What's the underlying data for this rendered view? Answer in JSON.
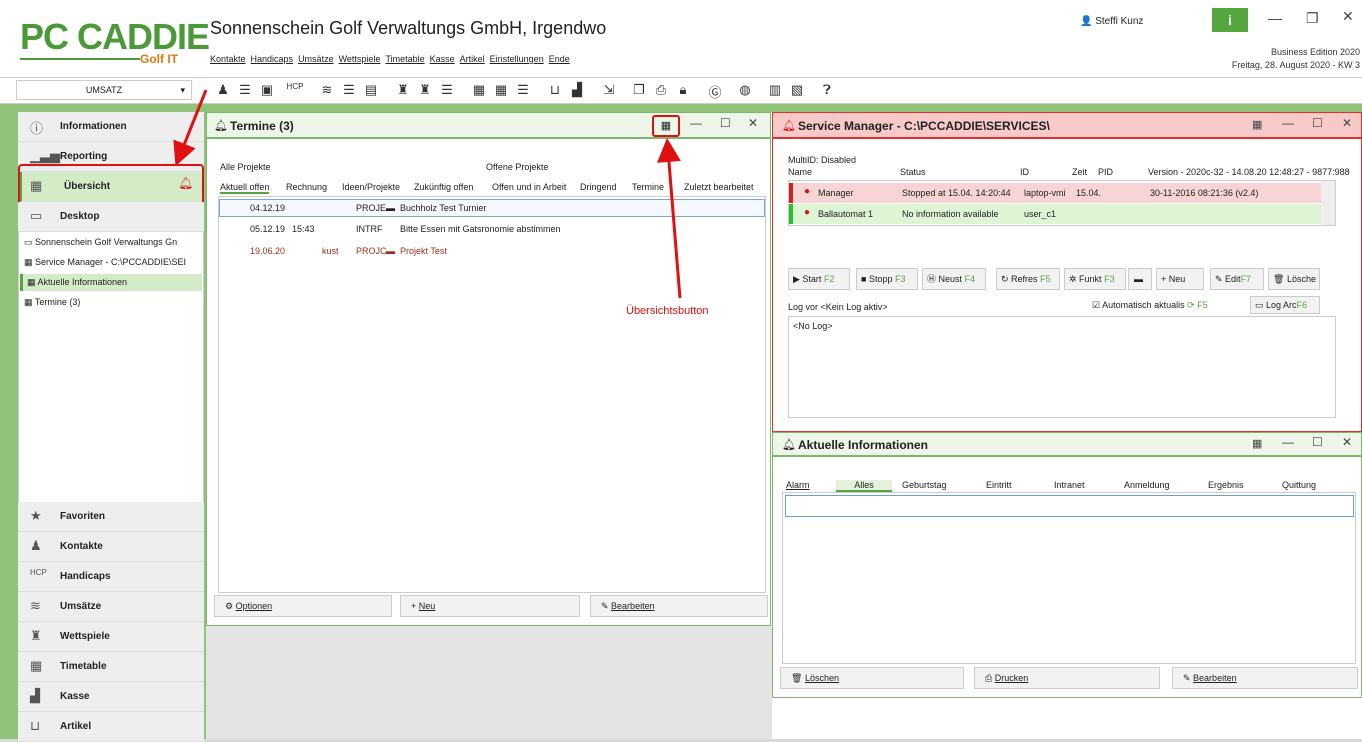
{
  "app": {
    "logo": "PC CADDIE",
    "logo_sub": "Golf IT",
    "title": "Sonnenschein Golf Verwaltungs GmbH, Irgendwo",
    "menu": [
      "Kontakte",
      "Handicaps",
      "Umsätze",
      "Wettspiele",
      "Timetable",
      "Kasse",
      "Artikel",
      "Einstellungen",
      "Ende"
    ],
    "user": "Steffi Kunz",
    "info": "i",
    "edition": "Business Edition 2020",
    "date": "Freitag, 28. August 2020 - KW 3"
  },
  "toolbar": {
    "dropdown": "UMSATZ"
  },
  "sidebar": {
    "sections": [
      "Informationen",
      "Reporting",
      "Übersicht",
      "Desktop"
    ],
    "items": [
      "Sonnenschein Golf Verwaltungs Gn",
      "Service Manager - C:\\PCCADDIE\\SEI",
      "Aktuelle Informationen",
      "Termine (3)"
    ],
    "bottom": [
      "Favoriten",
      "Kontakte",
      "Handicaps",
      "Umsätze",
      "Wettspiele",
      "Timetable",
      "Kasse",
      "Artikel"
    ]
  },
  "termine": {
    "title": "Termine (3)",
    "left_label": "Alle Projekte",
    "right_label": "Offene Projekte",
    "tabs": [
      "Aktuell offen",
      "Rechnung",
      "Ideen/Projekte",
      "Zukünftig offen",
      "Offen und in Arbeit",
      "Dringend",
      "Termine",
      "Zuletzt bearbeitet"
    ],
    "rows": [
      {
        "date": "04.12.19",
        "time": "",
        "who": "",
        "code": "PROJE",
        "text": "Buchholz Test Turnier"
      },
      {
        "date": "05.12.19",
        "time": "15:43",
        "who": "",
        "code": "INTRF",
        "text": "Bitte Essen mit Gatsronomie abstimmen"
      },
      {
        "date": "19.06.20",
        "time": "",
        "who": "kust",
        "code": "PROJC",
        "text": "Projekt Test"
      }
    ],
    "buttons": [
      "Optionen",
      "Neu",
      "Bearbeiten"
    ]
  },
  "annotation": "Übersichtsbutton",
  "service": {
    "title": "Service Manager - C:\\PCCADDIE\\SERVICES\\",
    "multi": "MultiID: Disabled",
    "headers": [
      "Name",
      "Status",
      "ID",
      "Zeit",
      "PID",
      "Version - 2020c-32 - 14.08.20 12:48:27 - 9877:988"
    ],
    "rows": [
      {
        "name": "Manager",
        "status": "Stopped at 15.04. 14:20:44",
        "id": "laptop-vmi",
        "zeit": "15.04.",
        "version": "30-11-2016 08:21:36 (v2.4)"
      },
      {
        "name": "Ballautomat 1",
        "status": "No information available",
        "id": "user_c1",
        "zeit": "",
        "version": ""
      }
    ],
    "buttons": [
      "Start",
      "Stopp",
      "Neust",
      "Refres",
      "Funkt",
      "Neu",
      "Edit",
      "Lösche"
    ],
    "keys": [
      "F2",
      "F3",
      "F4",
      "F5",
      "F3",
      "",
      "F7",
      ""
    ],
    "log_label": "Log vor <Kein Log aktiv>",
    "auto": "Automatisch aktualis",
    "auto_key": "F5",
    "log_arc": "Log Arc",
    "log_arc_key": "F6",
    "log_text": "<No Log>"
  },
  "aktuelle": {
    "title": "Aktuelle Informationen",
    "tabs": [
      "Alarm",
      "Alles",
      "Geburtstag",
      "Eintritt",
      "Intranet",
      "Anmeldung",
      "Ergebnis",
      "Quittung"
    ],
    "buttons": [
      "Löschen",
      "Drucken",
      "Bearbeiten"
    ]
  },
  "colors": {
    "green": "#56a640",
    "red": "#e01010"
  }
}
